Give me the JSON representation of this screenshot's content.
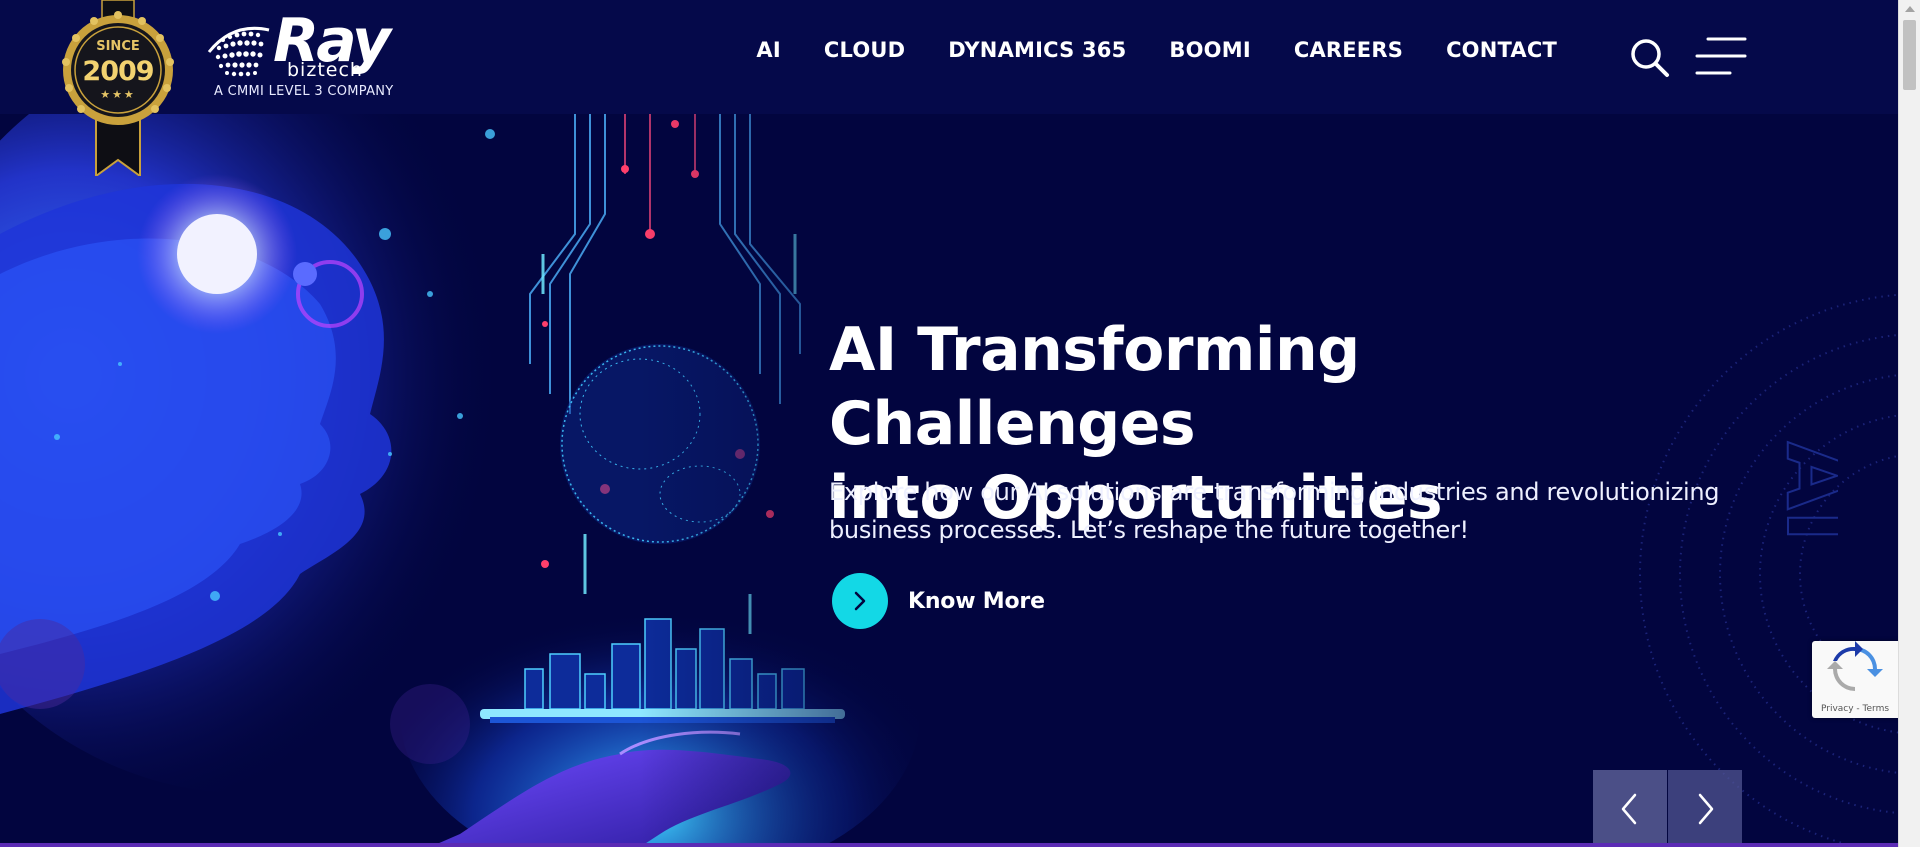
{
  "brand": {
    "badge_top": "SINCE",
    "badge_year": "2009",
    "logo_text": "Ray",
    "logo_sub_text": "biztech",
    "tagline": "A CMMI LEVEL 3 COMPANY"
  },
  "nav": {
    "items": [
      {
        "label": "AI"
      },
      {
        "label": "CLOUD"
      },
      {
        "label": "DYNAMICS 365"
      },
      {
        "label": "BOOMI"
      },
      {
        "label": "CAREERS"
      },
      {
        "label": "CONTACT"
      }
    ],
    "search_icon": "search-icon",
    "menu_icon": "hamburger-menu-icon"
  },
  "hero": {
    "title_line1": "AI Transforming Challenges",
    "title_line2": "into Opportunities",
    "subtitle_line1": "Explore how our AI solutions are transforming industries and revolutionizing",
    "subtitle_line2": "business processes. Let’s reshape the future together!",
    "cta_label": "Know More",
    "cta_icon": "chevron-right-icon",
    "watermark": "AI"
  },
  "slider": {
    "prev_icon": "chevron-left-icon",
    "next_icon": "chevron-right-icon"
  },
  "recaptcha": {
    "links": "Privacy - Terms"
  },
  "colors": {
    "header_bg": "#05094a",
    "hero_bg": "#02053f",
    "accent_cyan": "#13d8e6",
    "badge_gold": "#d4a93a"
  }
}
